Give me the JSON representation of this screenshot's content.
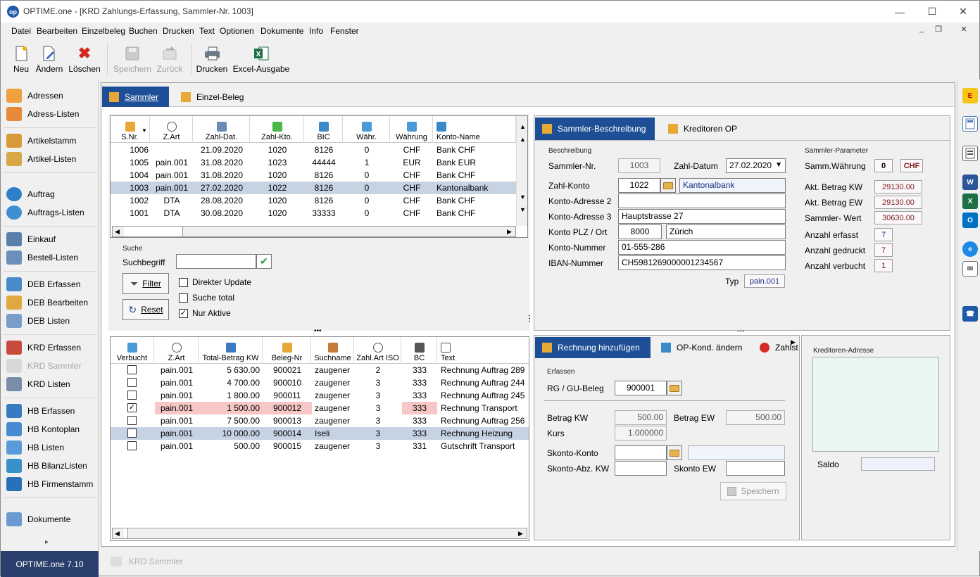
{
  "window": {
    "title": "OPTIME.one - [KRD Zahlungs-Erfassung, Sammler-Nr. 1003]",
    "logo_text": "op"
  },
  "menu": [
    "Datei",
    "Bearbeiten",
    "Einzelbeleg",
    "Buchen",
    "Drucken",
    "Text",
    "Optionen",
    "Dokumente",
    "Info",
    "Fenster"
  ],
  "toolbar": {
    "neu": "Neu",
    "aendern": "Ändern",
    "loeschen": "Löschen",
    "speichern": "Speichern",
    "zurueck": "Zurück",
    "drucken": "Drucken",
    "excel": "Excel-Ausgabe"
  },
  "sidebar": {
    "items": [
      "Adressen",
      "Adress-Listen",
      "Artikelstamm",
      "Artikel-Listen",
      "Auftrag",
      "Auftrags-Listen",
      "Einkauf",
      "Bestell-Listen",
      "DEB Erfassen",
      "DEB Bearbeiten",
      "DEB Listen",
      "KRD Erfassen",
      "KRD Sammler",
      "KRD Listen",
      "HB Erfassen",
      "HB Kontoplan",
      "HB Listen",
      "HB BilanzListen",
      "HB Firmenstamm",
      "Dokumente"
    ],
    "expand_glyph": "▸"
  },
  "version": "OPTIME.one  7.10",
  "status_item": "KRD Sammler",
  "tabs": {
    "sammler": "Sammler",
    "einzel": "Einzel-Beleg"
  },
  "sammler_grid": {
    "headers": [
      "S.Nr.",
      "Z.Art",
      "Zahl-Dat.",
      "Zahl-Kto.",
      "BIC",
      "Währ.",
      "Währung",
      "Konto-Name"
    ],
    "rows": [
      [
        "1006",
        "",
        "21.09.2020",
        "1020",
        "8126",
        "0",
        "CHF",
        "Bank CHF"
      ],
      [
        "1005",
        "pain.001",
        "31.08.2020",
        "1023",
        "44444",
        "1",
        "EUR",
        "Bank EUR"
      ],
      [
        "1004",
        "pain.001",
        "31.08.2020",
        "1020",
        "8126",
        "0",
        "CHF",
        "Bank CHF"
      ],
      [
        "1003",
        "pain.001",
        "27.02.2020",
        "1022",
        "8126",
        "0",
        "CHF",
        "Kantonalbank"
      ],
      [
        "1002",
        "DTA",
        "28.08.2020",
        "1020",
        "8126",
        "0",
        "CHF",
        "Bank CHF"
      ],
      [
        "1001",
        "DTA",
        "30.08.2020",
        "1020",
        "33333",
        "0",
        "CHF",
        "Bank CHF"
      ]
    ],
    "selected_index": 3
  },
  "suche": {
    "section": "Suche",
    "begriff_label": "Suchbegriff",
    "begriff_value": "",
    "filter": "Filter",
    "reset": "Reset",
    "direkter_update": "Direkter Update",
    "suche_total": "Suche total",
    "nur_aktive": "Nur Aktive",
    "direkter_update_checked": false,
    "suche_total_checked": false,
    "nur_aktive_checked": true
  },
  "beleg_grid": {
    "headers": [
      "Verbucht",
      "Z.Art",
      "Total-Betrag KW",
      "Beleg-Nr",
      "Suchname",
      "Zahl.Art ISO",
      "BC",
      "Text"
    ],
    "rows": [
      {
        "checked": false,
        "zart": "pain.001",
        "betrag": "5 630.00",
        "beleg": "900021",
        "such": "zaugener",
        "iso": "2",
        "bc": "333",
        "text": "Rechnung Auftrag 289"
      },
      {
        "checked": false,
        "zart": "pain.001",
        "betrag": "4 700.00",
        "beleg": "900010",
        "such": "zaugener",
        "iso": "3",
        "bc": "333",
        "text": "Rechnung Auftrag 244"
      },
      {
        "checked": false,
        "zart": "pain.001",
        "betrag": "1 800.00",
        "beleg": "900011",
        "such": "zaugener",
        "iso": "3",
        "bc": "333",
        "text": "Rechnung Auftrag 245"
      },
      {
        "checked": true,
        "zart": "pain.001",
        "betrag": "1 500.00",
        "beleg": "900012",
        "such": "zaugener",
        "iso": "3",
        "bc": "333",
        "text": "Rechnung Transport"
      },
      {
        "checked": false,
        "zart": "pain.001",
        "betrag": "7 500.00",
        "beleg": "900013",
        "such": "zaugener",
        "iso": "3",
        "bc": "333",
        "text": "Rechnung Auftrag 256"
      },
      {
        "checked": false,
        "zart": "pain.001",
        "betrag": "10 000.00",
        "beleg": "900014",
        "such": "Iseli",
        "iso": "3",
        "bc": "333",
        "text": "Rechnung Heizung"
      },
      {
        "checked": false,
        "zart": "pain.001",
        "betrag": "500.00",
        "beleg": "900015",
        "such": "zaugener",
        "iso": "3",
        "bc": "331",
        "text": "Gutschrift Transport"
      }
    ]
  },
  "beschreibung": {
    "tab_active": "Sammler-Beschreibung",
    "tab_other": "Kreditoren OP",
    "section": "Beschreibung",
    "sammler_nr_label": "Sammler-Nr.",
    "sammler_nr": "1003",
    "zahl_datum_label": "Zahl-Datum",
    "zahl_datum": "27.02.2020",
    "zahl_konto_label": "Zahl-Konto",
    "zahl_konto": "1022",
    "zahl_konto_name": "Kantonalbank",
    "adr2_label": "Konto-Adresse 2",
    "adr2": "",
    "adr3_label": "Konto-Adresse 3",
    "adr3": "Hauptstrasse 27",
    "plz_label": "Konto PLZ / Ort",
    "plz": "8000",
    "ort": "Zürich",
    "nummer_label": "Konto-Nummer",
    "nummer": "01-555-286",
    "iban_label": "IBAN-Nummer",
    "iban": "CH5981269000001234567",
    "typ_label": "Typ",
    "typ": "pain.001",
    "param_section": "Sammler-Parameter",
    "waehrung_label": "Samm.Währung",
    "waehrung_code": "0",
    "waehrung": "CHF",
    "betrag_kw_label": "Akt. Betrag KW",
    "betrag_kw": "29130.00",
    "betrag_ew_label": "Akt. Betrag EW",
    "betrag_ew": "29130.00",
    "wert_label": "Sammler- Wert",
    "wert": "30630.00",
    "erfasst_label": "Anzahl erfasst",
    "erfasst": "7",
    "gedruckt_label": "Anzahl gedruckt",
    "gedruckt": "7",
    "verbucht_label": "Anzahl verbucht",
    "verbucht": "1"
  },
  "rechnung": {
    "tab_active": "Rechnung hinzufügen",
    "tab2": "OP-Kond. ändern",
    "tab3": "Zahlst",
    "section": "Erfassen",
    "beleg_label": "RG / GU-Beleg",
    "beleg": "900001",
    "betrag_kw_label": "Betrag KW",
    "betrag_kw": "500.00",
    "betrag_ew_label": "Betrag EW",
    "betrag_ew": "500.00",
    "kurs_label": "Kurs",
    "kurs": "1.000000",
    "skonto_konto_label": "Skonto-Konto",
    "skonto_konto": "",
    "skonto_name": "",
    "skonto_kw_label": "Skonto-Abz. KW",
    "skonto_kw": "",
    "skonto_ew_label": "Skonto EW",
    "skonto_ew": "",
    "speichern": "Speichern",
    "adresse_label": "Kreditoren-Adresse",
    "saldo_label": "Saldo",
    "saldo": ""
  }
}
